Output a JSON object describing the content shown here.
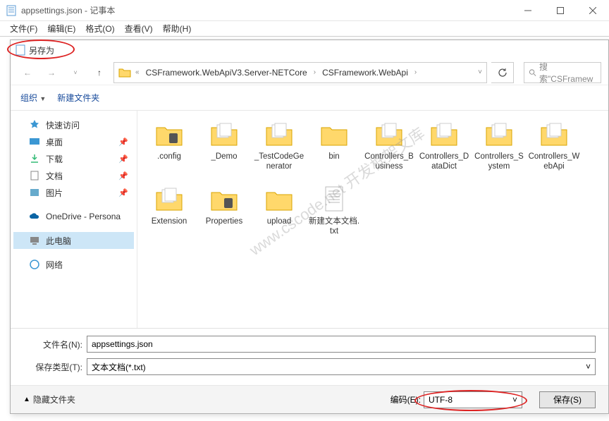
{
  "window": {
    "title": "appsettings.json - 记事本",
    "menus": [
      "文件(F)",
      "编辑(E)",
      "格式(O)",
      "查看(V)",
      "帮助(H)"
    ]
  },
  "dialog": {
    "title": "另存为",
    "breadcrumb": {
      "prefix": "«",
      "parts": [
        "CSFramework.WebApiV3.Server-NETCore",
        "CSFramework.WebApi"
      ]
    },
    "search_placeholder": "搜索\"CSFramew",
    "toolbar": {
      "organize": "组织",
      "newfolder": "新建文件夹"
    },
    "sidebar": {
      "quick": "快速访问",
      "desktop": "桌面",
      "downloads": "下载",
      "documents": "文档",
      "pictures": "图片",
      "onedrive": "OneDrive - Persona",
      "thispc": "此电脑",
      "network": "网络"
    },
    "files": [
      {
        "label": ".config",
        "type": "folder-special"
      },
      {
        "label": "_Demo",
        "type": "folder-open"
      },
      {
        "label": "_TestCodeGenerator",
        "type": "folder-open"
      },
      {
        "label": "bin",
        "type": "folder"
      },
      {
        "label": "Controllers_Business",
        "type": "folder-open"
      },
      {
        "label": "Controllers_DataDict",
        "type": "folder-open"
      },
      {
        "label": "Controllers_System",
        "type": "folder-open"
      },
      {
        "label": "Controllers_WebApi",
        "type": "folder-open"
      },
      {
        "label": "Extension",
        "type": "folder-open"
      },
      {
        "label": "Properties",
        "type": "folder-special"
      },
      {
        "label": "upload",
        "type": "folder"
      },
      {
        "label": "新建文本文档.txt",
        "type": "textfile"
      }
    ],
    "filename_label": "文件名(N):",
    "filename_value": "appsettings.json",
    "filetype_label": "保存类型(T):",
    "filetype_value": "文本文档(*.txt)",
    "hide_folders": "隐藏文件夹",
    "encoding_label": "编码(E):",
    "encoding_value": "UTF-8",
    "save_btn": "保存(S)"
  },
  "watermark": "www.cscode.net\n开发框架文库"
}
